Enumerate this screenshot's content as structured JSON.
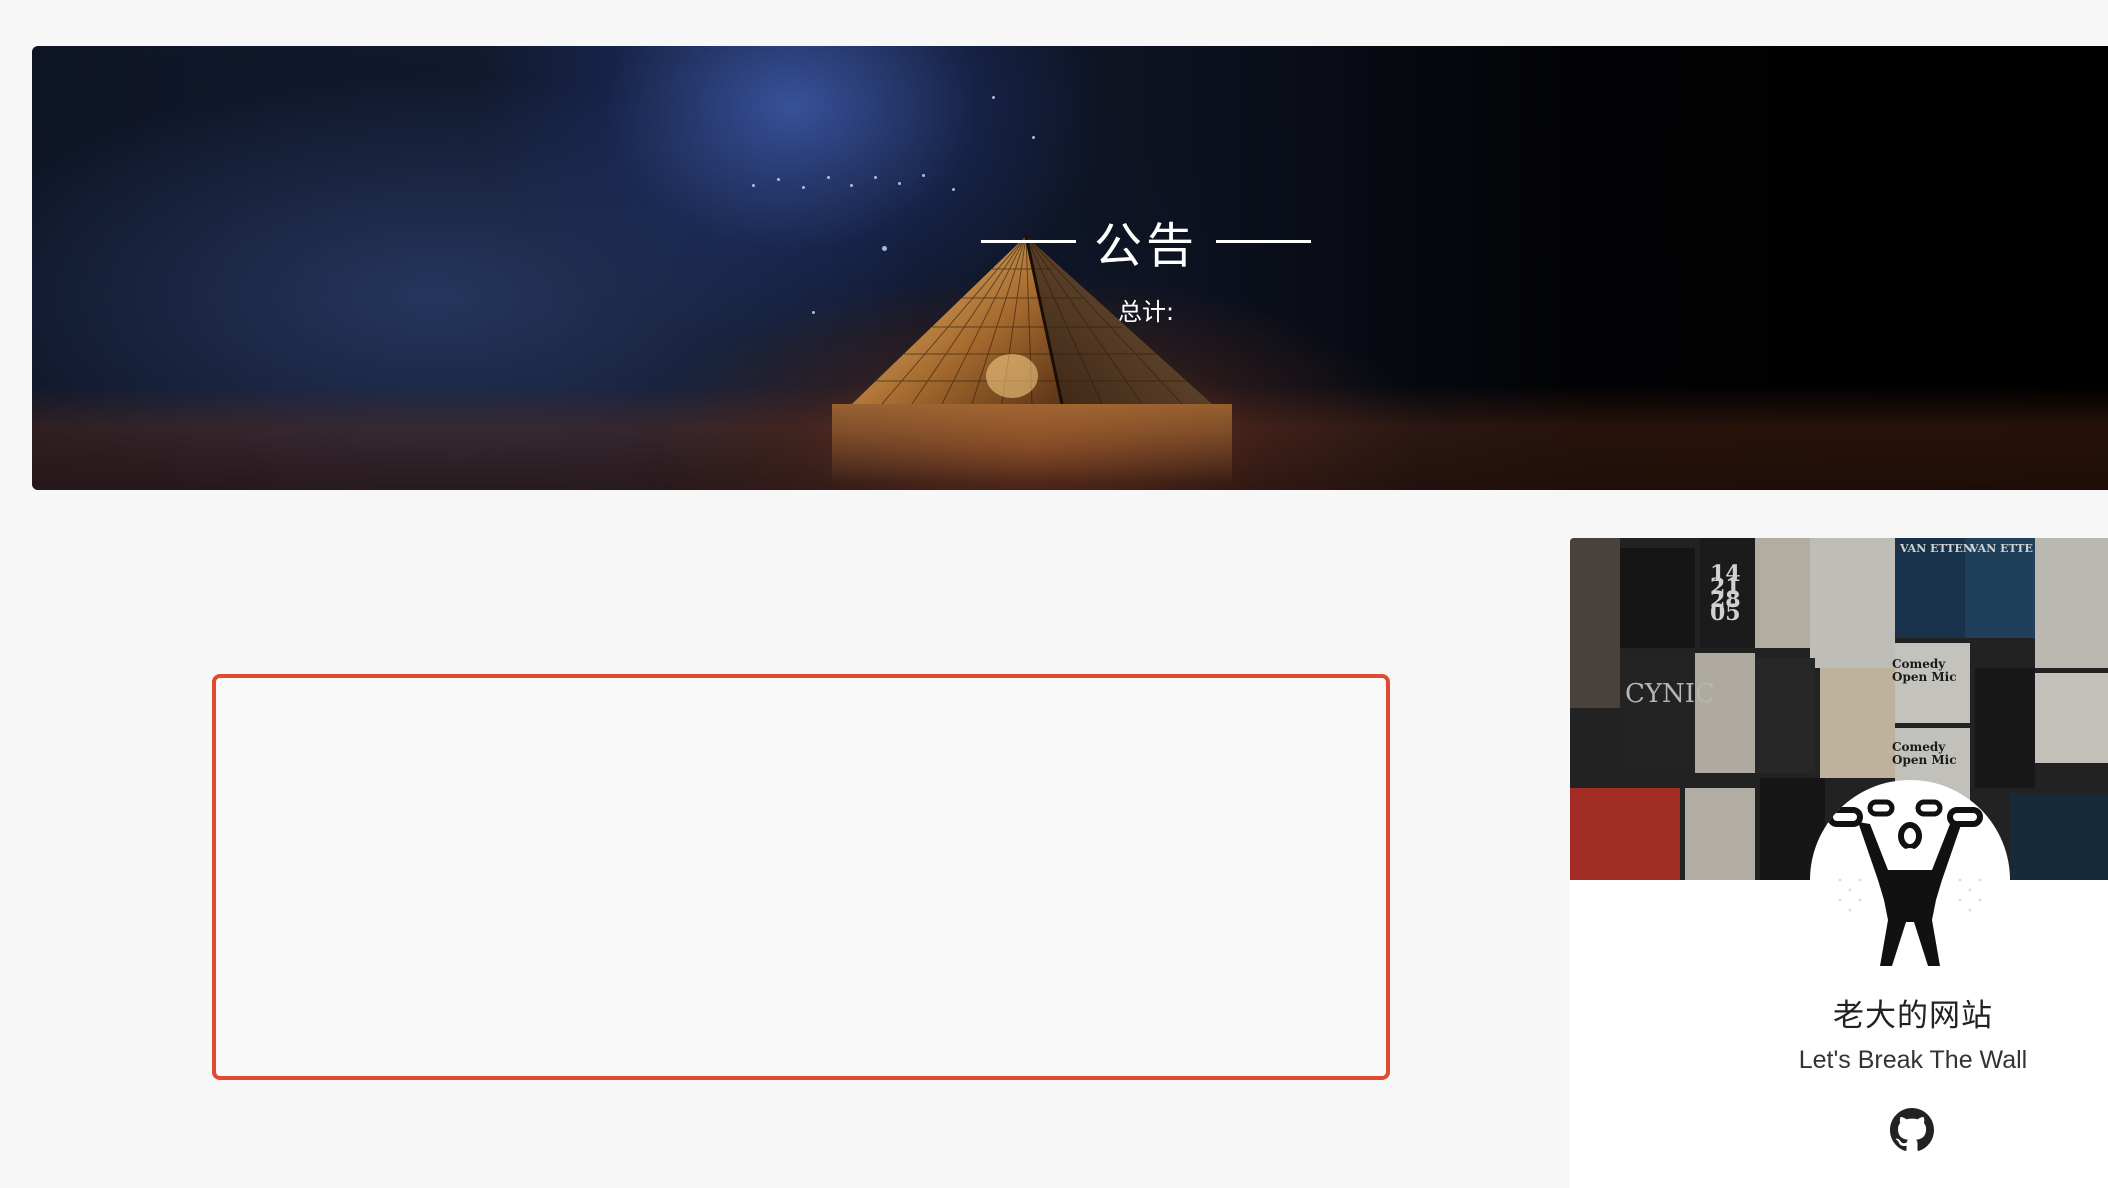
{
  "banner": {
    "title": "公告",
    "count_label": "总计:"
  },
  "author": {
    "name": "老大的网站",
    "tagline": "Let's Break The Wall",
    "social": [
      {
        "icon": "github-icon"
      }
    ]
  },
  "colors": {
    "page_background": "#f7f7f7",
    "highlight_border": "#e04a32",
    "card_background": "#ffffff"
  }
}
